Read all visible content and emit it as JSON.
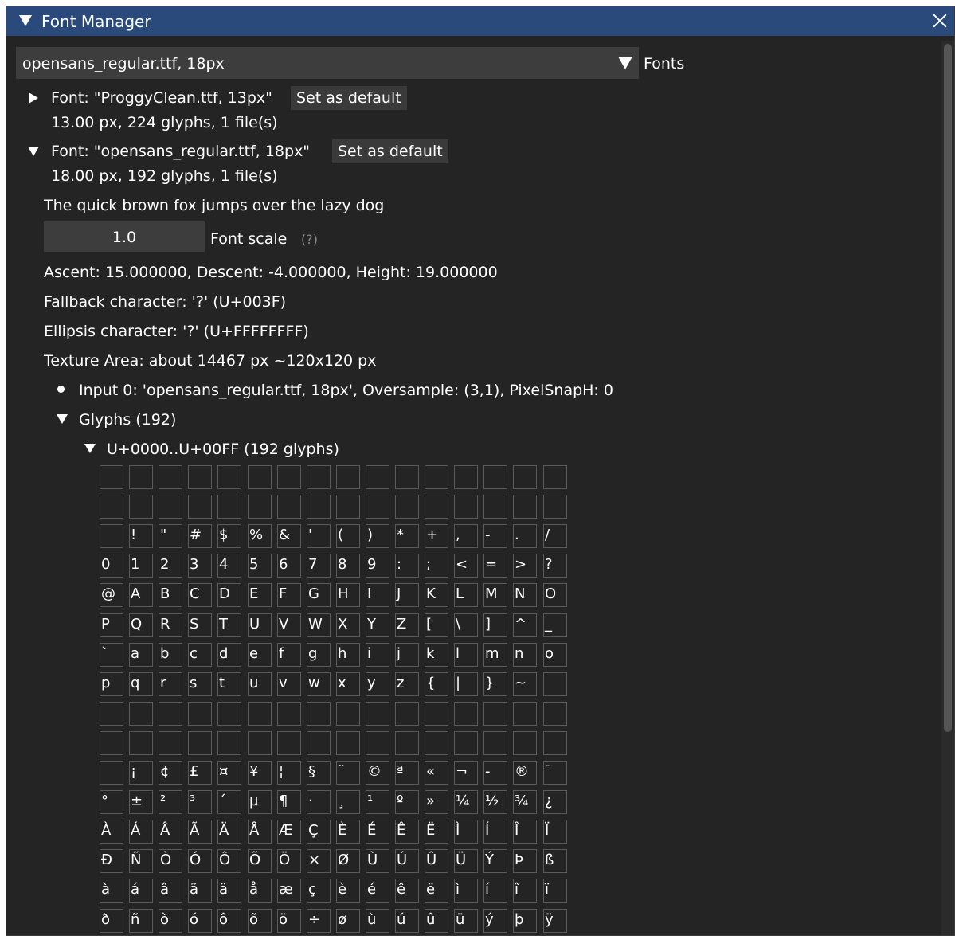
{
  "window": {
    "title": "Font Manager"
  },
  "fonts_combo": {
    "value": "opensans_regular.ttf, 18px",
    "label": "Fonts"
  },
  "font_items": [
    {
      "header": "Font: \"ProggyClean.ttf, 13px\"",
      "button": "Set as default",
      "info": "13.00 px, 224 glyphs, 1 file(s)",
      "expanded": false
    },
    {
      "header": "Font: \"opensans_regular.ttf, 18px\"",
      "button": "Set as default",
      "info": "18.00 px, 192 glyphs, 1 file(s)",
      "expanded": true
    }
  ],
  "details": {
    "sample": "The quick brown fox jumps over the lazy dog",
    "scale_value": "1.0",
    "scale_label": "Font scale",
    "scale_help": "(?)",
    "metrics": "Ascent: 15.000000, Descent: -4.000000, Height: 19.000000",
    "fallback": "Fallback character: '?' (U+003F)",
    "ellipsis": "Ellipsis character: '?' (U+FFFFFFFF)",
    "texture": "Texture Area: about 14467 px ~120x120 px",
    "input": "Input 0: 'opensans_regular.ttf, 18px', Oversample: (3,1), PixelSnapH: 0",
    "glyphs_header": "Glyphs (192)",
    "range_header": "U+0000..U+00FF (192 glyphs)"
  },
  "glyph_rows": [
    [
      "",
      "",
      "",
      "",
      "",
      "",
      "",
      "",
      "",
      "",
      "",
      "",
      "",
      "",
      "",
      ""
    ],
    [
      "",
      "",
      "",
      "",
      "",
      "",
      "",
      "",
      "",
      "",
      "",
      "",
      "",
      "",
      "",
      ""
    ],
    [
      " ",
      "!",
      "\"",
      "#",
      "$",
      "%",
      "&",
      "'",
      "(",
      ")",
      "*",
      "+",
      ",",
      "-",
      ".",
      "/"
    ],
    [
      "0",
      "1",
      "2",
      "3",
      "4",
      "5",
      "6",
      "7",
      "8",
      "9",
      ":",
      ";",
      "<",
      "=",
      ">",
      "?"
    ],
    [
      "@",
      "A",
      "B",
      "C",
      "D",
      "E",
      "F",
      "G",
      "H",
      "I",
      "J",
      "K",
      "L",
      "M",
      "N",
      "O"
    ],
    [
      "P",
      "Q",
      "R",
      "S",
      "T",
      "U",
      "V",
      "W",
      "X",
      "Y",
      "Z",
      "[",
      "\\",
      "]",
      "^",
      "_"
    ],
    [
      "`",
      "a",
      "b",
      "c",
      "d",
      "e",
      "f",
      "g",
      "h",
      "i",
      "j",
      "k",
      "l",
      "m",
      "n",
      "o"
    ],
    [
      "p",
      "q",
      "r",
      "s",
      "t",
      "u",
      "v",
      "w",
      "x",
      "y",
      "z",
      "{",
      "|",
      "}",
      "~",
      ""
    ],
    [
      "",
      "",
      "",
      "",
      "",
      "",
      "",
      "",
      "",
      "",
      "",
      "",
      "",
      "",
      "",
      ""
    ],
    [
      "",
      "",
      "",
      "",
      "",
      "",
      "",
      "",
      "",
      "",
      "",
      "",
      "",
      "",
      "",
      ""
    ],
    [
      " ",
      "¡",
      "¢",
      "£",
      "¤",
      "¥",
      "¦",
      "§",
      "¨",
      "©",
      "ª",
      "«",
      "¬",
      "-",
      "®",
      "¯"
    ],
    [
      "°",
      "±",
      "²",
      "³",
      "´",
      "µ",
      "¶",
      "·",
      "¸",
      "¹",
      "º",
      "»",
      "¼",
      "½",
      "¾",
      "¿"
    ],
    [
      "À",
      "Á",
      "Â",
      "Ã",
      "Ä",
      "Å",
      "Æ",
      "Ç",
      "È",
      "É",
      "Ê",
      "Ë",
      "Ì",
      "Í",
      "Î",
      "Ï"
    ],
    [
      "Ð",
      "Ñ",
      "Ò",
      "Ó",
      "Ô",
      "Õ",
      "Ö",
      "×",
      "Ø",
      "Ù",
      "Ú",
      "Û",
      "Ü",
      "Ý",
      "Þ",
      "ß"
    ],
    [
      "à",
      "á",
      "â",
      "ã",
      "ä",
      "å",
      "æ",
      "ç",
      "è",
      "é",
      "ê",
      "ë",
      "ì",
      "í",
      "î",
      "ï"
    ],
    [
      "ð",
      "ñ",
      "ò",
      "ó",
      "ô",
      "õ",
      "ö",
      "÷",
      "ø",
      "ù",
      "ú",
      "û",
      "ü",
      "ý",
      "þ",
      "ÿ"
    ]
  ]
}
